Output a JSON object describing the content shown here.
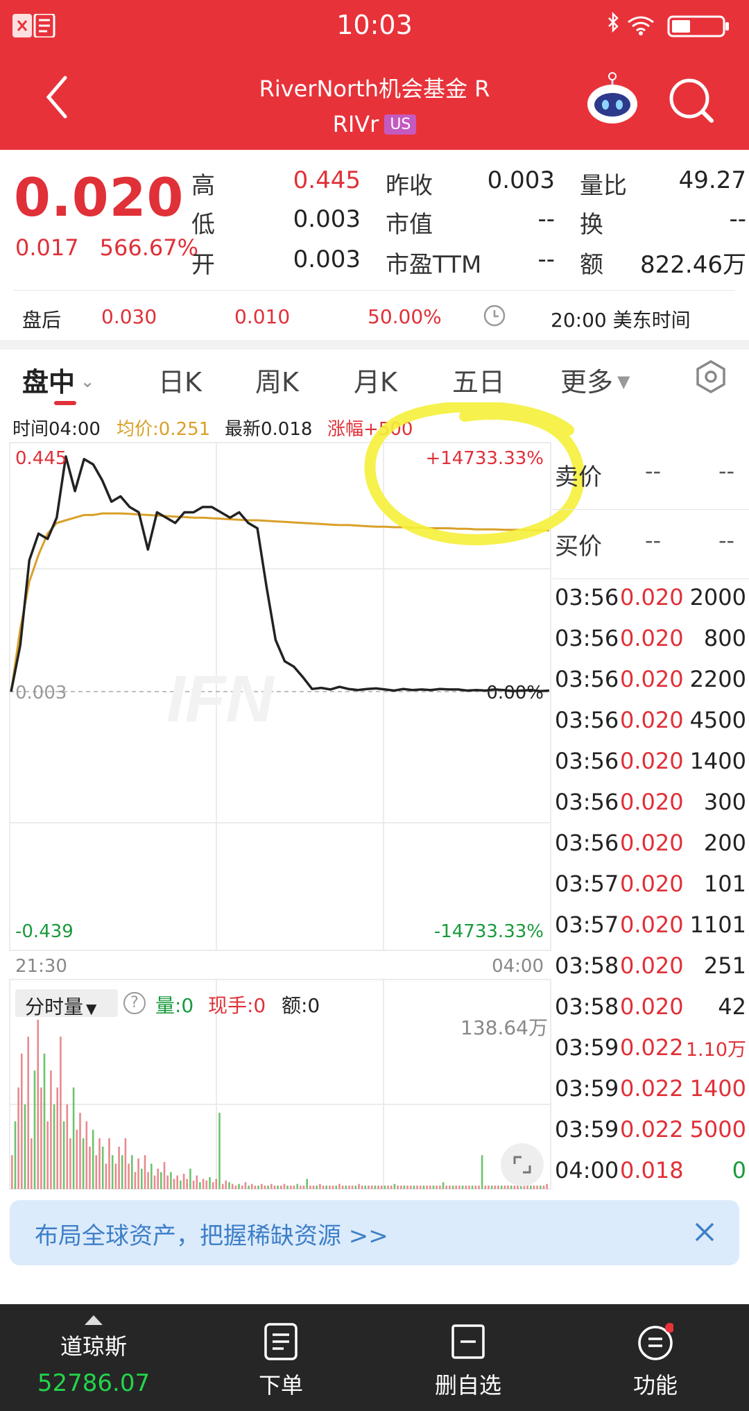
{
  "status_bar": {
    "time": "10:03"
  },
  "header": {
    "title": "RiverNorth机会基金 R",
    "ticker": "RIVr",
    "market_badge": "US"
  },
  "quote": {
    "price": "0.020",
    "change": "0.017",
    "change_pct": "566.67%",
    "stats": [
      {
        "label": "高",
        "value": "0.445"
      },
      {
        "label": "低",
        "value": "0.003"
      },
      {
        "label": "开",
        "value": "0.003"
      },
      {
        "label": "昨收",
        "value": "0.003"
      },
      {
        "label": "市值",
        "value": "--"
      },
      {
        "label": "市盈TTM",
        "value": "--"
      },
      {
        "label": "量比",
        "value": "49.27"
      },
      {
        "label": "换",
        "value": "--"
      },
      {
        "label": "额",
        "value": "822.46万"
      }
    ]
  },
  "after_hours": {
    "label": "盘后",
    "price": "0.030",
    "change": "0.010",
    "change_pct": "50.00%",
    "time": "20:00 美东时间"
  },
  "tabs": [
    "盘中",
    "日K",
    "周K",
    "月K",
    "五日",
    "更多"
  ],
  "chart_info": {
    "time": "时间04:00",
    "avg": "均价:0.251",
    "latest": "最新0.018",
    "change": "涨幅+500"
  },
  "chart_data": {
    "type": "line",
    "x_range": [
      "21:30",
      "04:00"
    ],
    "ylim": [
      -0.439,
      0.445
    ],
    "base": 0.003,
    "y_labels": {
      "top": "0.445",
      "base": "0.003",
      "bottom": "-0.439"
    },
    "pct_labels": {
      "top": "+14733.33%",
      "base": "0.00%",
      "bottom": "-14733.33%"
    },
    "series": [
      {
        "color": "#222222",
        "values": [
          0.003,
          0.09,
          0.25,
          0.3,
          0.29,
          0.33,
          0.445,
          0.38,
          0.44,
          0.43,
          0.4,
          0.36,
          0.37,
          0.35,
          0.34,
          0.27,
          0.34,
          0.33,
          0.32,
          0.34,
          0.34,
          0.35,
          0.35,
          0.34,
          0.33,
          0.34,
          0.32,
          0.31,
          0.2,
          0.1,
          0.06,
          0.05,
          0.03,
          0.008,
          0.01,
          0.007,
          0.012,
          0.008,
          0.006,
          0.008,
          0.009,
          0.007,
          0.005,
          0.008,
          0.006,
          0.007,
          0.006,
          0.008,
          0.007,
          0.007,
          0.005,
          0.006,
          0.005,
          0.007,
          0.006,
          0.004,
          0.005,
          0.006,
          0.004,
          0.005
        ]
      },
      {
        "color": "#d9a028",
        "values": [
          0.003,
          0.12,
          0.21,
          0.26,
          0.3,
          0.32,
          0.325,
          0.33,
          0.335,
          0.335,
          0.338,
          0.338,
          0.338,
          0.337,
          0.336,
          0.335,
          0.334,
          0.333,
          0.332,
          0.331,
          0.33,
          0.33,
          0.329,
          0.328,
          0.327,
          0.326,
          0.325,
          0.325,
          0.324,
          0.323,
          0.322,
          0.321,
          0.32,
          0.319,
          0.318,
          0.317,
          0.316,
          0.316,
          0.315,
          0.314,
          0.313,
          0.313,
          0.312,
          0.312,
          0.311,
          0.311,
          0.31,
          0.31,
          0.31,
          0.309,
          0.309,
          0.308,
          0.308,
          0.308,
          0.307,
          0.307,
          0.307,
          0.306,
          0.306,
          0.306
        ]
      }
    ],
    "volume": {
      "max_label": "138.64万",
      "values": [
        0.2,
        0.4,
        0.6,
        0.8,
        0.5,
        0.9,
        0.3,
        0.7,
        1.0,
        0.6,
        0.8,
        0.4,
        0.7,
        0.5,
        0.6,
        0.9,
        0.4,
        0.5,
        0.3,
        0.6,
        0.35,
        0.45,
        0.3,
        0.4,
        0.25,
        0.35,
        0.2,
        0.3,
        0.25,
        0.15,
        0.3,
        0.2,
        0.15,
        0.25,
        0.2,
        0.3,
        0.15,
        0.2,
        0.1,
        0.18,
        0.12,
        0.2,
        0.1,
        0.15,
        0.08,
        0.12,
        0.1,
        0.16,
        0.08,
        0.1,
        0.06,
        0.08,
        0.05,
        0.09,
        0.06,
        0.12,
        0.05,
        0.08,
        0.04,
        0.06,
        0.05,
        0.07,
        0.04,
        0.06,
        0.45,
        0.03,
        0.05,
        0.04,
        0.03,
        0.02,
        0.03,
        0.02,
        0.04,
        0.02,
        0.03,
        0.02,
        0.02,
        0.03,
        0.02,
        0.02,
        0.03,
        0.02,
        0.02,
        0.02,
        0.03,
        0.02,
        0.02,
        0.02,
        0.03,
        0.02,
        0.02,
        0.06,
        0.02,
        0.02,
        0.02,
        0.03,
        0.02,
        0.02,
        0.02,
        0.02,
        0.02,
        0.03,
        0.02,
        0.02,
        0.02,
        0.02,
        0.02,
        0.03,
        0.02,
        0.02,
        0.02,
        0.02,
        0.02,
        0.02,
        0.02,
        0.02,
        0.02,
        0.02,
        0.03,
        0.02,
        0.02,
        0.02,
        0.02,
        0.02,
        0.02,
        0.02,
        0.02,
        0.02,
        0.02,
        0.02,
        0.02,
        0.02,
        0.02,
        0.04,
        0.02,
        0.02,
        0.02,
        0.02,
        0.02,
        0.02,
        0.02,
        0.02,
        0.02,
        0.02,
        0.02,
        0.2,
        0.02,
        0.02,
        0.02,
        0.02,
        0.02,
        0.02,
        0.02,
        0.02,
        0.02,
        0.02,
        0.02,
        0.02,
        0.02,
        0.02,
        0.02,
        0.02,
        0.02,
        0.02,
        0.02,
        0.03
      ]
    }
  },
  "order_book": [
    {
      "label": "卖价",
      "price": "--",
      "size": "--"
    },
    {
      "label": "买价",
      "price": "--",
      "size": "--"
    }
  ],
  "trades": [
    {
      "time": "03:56",
      "price": "0.020",
      "volume": "2000",
      "color": "#222222"
    },
    {
      "time": "03:56",
      "price": "0.020",
      "volume": "800",
      "color": "#222222"
    },
    {
      "time": "03:56",
      "price": "0.020",
      "volume": "2200",
      "color": "#222222"
    },
    {
      "time": "03:56",
      "price": "0.020",
      "volume": "4500",
      "color": "#222222"
    },
    {
      "time": "03:56",
      "price": "0.020",
      "volume": "1400",
      "color": "#222222"
    },
    {
      "time": "03:56",
      "price": "0.020",
      "volume": "300",
      "color": "#222222"
    },
    {
      "time": "03:56",
      "price": "0.020",
      "volume": "200",
      "color": "#222222"
    },
    {
      "time": "03:57",
      "price": "0.020",
      "volume": "101",
      "color": "#222222"
    },
    {
      "time": "03:57",
      "price": "0.020",
      "volume": "1101",
      "color": "#222222"
    },
    {
      "time": "03:58",
      "price": "0.020",
      "volume": "251",
      "color": "#222222"
    },
    {
      "time": "03:58",
      "price": "0.020",
      "volume": "42",
      "color": "#222222"
    },
    {
      "time": "03:59",
      "price": "0.022",
      "volume": "1.10万",
      "color": "#e03038"
    },
    {
      "time": "03:59",
      "price": "0.022",
      "volume": "1400",
      "color": "#e03038"
    },
    {
      "time": "03:59",
      "price": "0.022",
      "volume": "5000",
      "color": "#e03038"
    },
    {
      "time": "04:00",
      "price": "0.018",
      "volume": "0",
      "color": "#1a9a3c"
    }
  ],
  "volume_header": {
    "selector": "分时量",
    "vol": "量:0",
    "hand": "现手:0",
    "amount": "额:0"
  },
  "banner": {
    "text": "布局全球资产，把握稀缺资源  >>"
  },
  "bottom_nav": {
    "index_name": "道琼斯",
    "index_value": "52786.07",
    "items": [
      "下单",
      "删自选",
      "功能"
    ]
  },
  "colors": {
    "brand_red": "#e8323a",
    "up": "#e03038",
    "down": "#1a9a3c",
    "avg_line": "#d9a028",
    "nav_bg": "#262626",
    "highlight": "#f5f03a"
  }
}
